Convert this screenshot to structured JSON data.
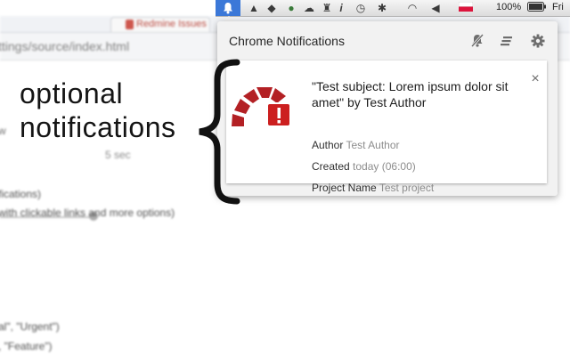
{
  "menubar": {
    "battery_percent": "100%",
    "day": "Fri"
  },
  "browser": {
    "tab_title": "Redmine Issues",
    "address": "ttings/source/index.html"
  },
  "background_page": {
    "slider_value_label": "5 sec",
    "line_prefix": "w",
    "lines": [
      "fications)",
      "with clickable links and more options)",
      "al\", \"Urgent\")",
      ", \"Feature\")"
    ]
  },
  "annotation": {
    "line1": "optional",
    "line2": "notifications"
  },
  "panel": {
    "title": "Chrome Notifications",
    "icons": [
      "mute-icon",
      "clear-all-icon",
      "settings-icon"
    ]
  },
  "notification": {
    "title": "\"Test subject: Lorem ipsum dolor sit amet\" by Test Author",
    "close_glyph": "×",
    "fields": {
      "author_label": "Author",
      "author_value": "Test Author",
      "created_label": "Created",
      "created_value": "today (06:00)",
      "project_label": "Project Name",
      "project_value": "Test project"
    }
  },
  "colors": {
    "menubar_accent": "#3b78d8",
    "redmine_red": "#b32024",
    "muted_text": "#8d8d8d"
  }
}
